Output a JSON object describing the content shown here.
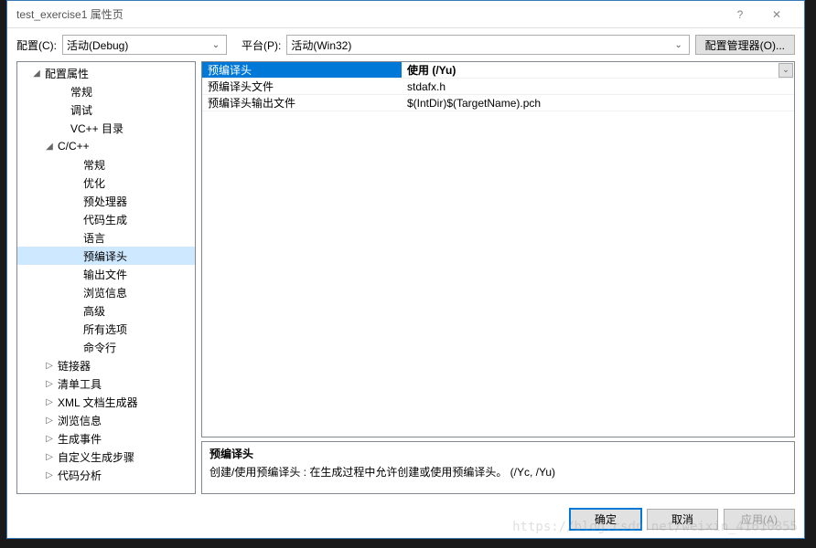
{
  "window": {
    "title": "test_exercise1 属性页",
    "help": "?",
    "close": "✕"
  },
  "toolbar": {
    "config_label": "配置(C):",
    "config_value": "活动(Debug)",
    "platform_label": "平台(P):",
    "platform_value": "活动(Win32)",
    "config_mgr": "配置管理器(O)..."
  },
  "tree": [
    {
      "indent": 1,
      "exp": "◢",
      "label": "配置属性"
    },
    {
      "indent": 3,
      "exp": "",
      "label": "常规"
    },
    {
      "indent": 3,
      "exp": "",
      "label": "调试"
    },
    {
      "indent": 3,
      "exp": "",
      "label": "VC++ 目录"
    },
    {
      "indent": 2,
      "exp": "◢",
      "label": "C/C++"
    },
    {
      "indent": 4,
      "exp": "",
      "label": "常规"
    },
    {
      "indent": 4,
      "exp": "",
      "label": "优化"
    },
    {
      "indent": 4,
      "exp": "",
      "label": "预处理器"
    },
    {
      "indent": 4,
      "exp": "",
      "label": "代码生成"
    },
    {
      "indent": 4,
      "exp": "",
      "label": "语言"
    },
    {
      "indent": 4,
      "exp": "",
      "label": "预编译头",
      "selected": true
    },
    {
      "indent": 4,
      "exp": "",
      "label": "输出文件"
    },
    {
      "indent": 4,
      "exp": "",
      "label": "浏览信息"
    },
    {
      "indent": 4,
      "exp": "",
      "label": "高级"
    },
    {
      "indent": 4,
      "exp": "",
      "label": "所有选项"
    },
    {
      "indent": 4,
      "exp": "",
      "label": "命令行"
    },
    {
      "indent": 2,
      "exp": "▷",
      "label": "链接器"
    },
    {
      "indent": 2,
      "exp": "▷",
      "label": "清单工具"
    },
    {
      "indent": 2,
      "exp": "▷",
      "label": "XML 文档生成器"
    },
    {
      "indent": 2,
      "exp": "▷",
      "label": "浏览信息"
    },
    {
      "indent": 2,
      "exp": "▷",
      "label": "生成事件"
    },
    {
      "indent": 2,
      "exp": "▷",
      "label": "自定义生成步骤"
    },
    {
      "indent": 2,
      "exp": "▷",
      "label": "代码分析"
    }
  ],
  "grid": [
    {
      "label": "预编译头",
      "value": "使用 (/Yu)",
      "selected": true,
      "dropdown": true
    },
    {
      "label": "预编译头文件",
      "value": "stdafx.h"
    },
    {
      "label": "预编译头输出文件",
      "value": "$(IntDir)$(TargetName).pch"
    }
  ],
  "desc": {
    "title": "预编译头",
    "text": "创建/使用预编译头 : 在生成过程中允许创建或使用预编译头。     (/Yc, /Yu)"
  },
  "buttons": {
    "ok": "确定",
    "cancel": "取消",
    "apply": "应用(A)"
  },
  "watermark": "https://blog.csdn.net/weixin_41610855"
}
